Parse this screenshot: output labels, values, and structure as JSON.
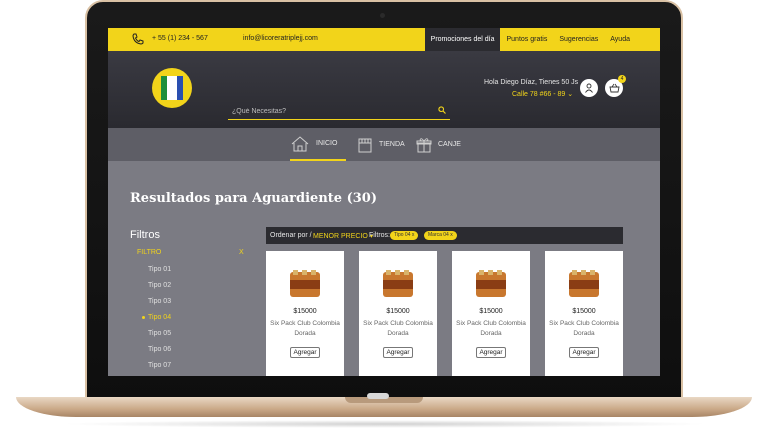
{
  "topbar": {
    "phone": "+ 55 (1) 234 - 567",
    "email": "info@licoreratriplejj.com",
    "nav": [
      "Promociones del día",
      "Puntos gratis",
      "Sugerencias",
      "Ayuda"
    ]
  },
  "header": {
    "search_placeholder": "¿Qué Necesitas?",
    "greeting": "Hola Diego Díaz, Tienes 50 Js",
    "address": "Calle 78 #66 - 89",
    "cart_count": "4"
  },
  "mainnav": [
    "INICIO",
    "TIENDA",
    "CANJE"
  ],
  "results_title": "Resultados para Aguardiente (30)",
  "filters": {
    "title": "Filtros",
    "label": "FILTRO",
    "clear": "X",
    "types": [
      "Tipo 01",
      "Tipo 02",
      "Tipo 03",
      "Tipo 04",
      "Tipo 05",
      "Tipo 06",
      "Tipo 07"
    ],
    "selected": "Tipo 04"
  },
  "sortbar": {
    "sort_label": "Ordenar por /",
    "sort_value": "MENOR PRECIO ▾",
    "filter_label": "Filtros:",
    "chips": [
      "Tipo 04  x",
      "Marca 04  x"
    ]
  },
  "products": [
    {
      "price": "$15000",
      "name_line1": "Six Pack Club Colombia",
      "name_line2": "Dorada",
      "button": "Agregar"
    },
    {
      "price": "$15000",
      "name_line1": "Six Pack Club Colombia",
      "name_line2": "Dorada",
      "button": "Agregar"
    },
    {
      "price": "$15000",
      "name_line1": "Six Pack Club Colombia",
      "name_line2": "Dorada",
      "button": "Agregar"
    },
    {
      "price": "$15000",
      "name_line1": "Six Pack Club Colombia",
      "name_line2": "Dorada",
      "button": "Agregar"
    }
  ],
  "colors": {
    "accent": "#f2d41a",
    "dark": "#2b2b30",
    "content_bg": "#7b7b83"
  }
}
